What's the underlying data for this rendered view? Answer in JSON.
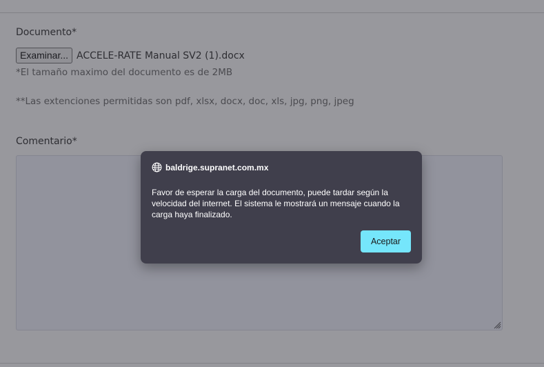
{
  "form": {
    "document_label": "Documento*",
    "browse_button_label": "Examinar...",
    "selected_file_name": "ACCELE-RATE Manual SV2 (1).docx",
    "max_size_note": "*El tamaño maximo del documento es de 2MB",
    "allowed_extensions_note": "**Las extenciones permitidas son pdf, xlsx, docx, doc, xls, jpg, png, jpeg",
    "comment_label": "Comentario*",
    "comment_value": ""
  },
  "dialog": {
    "origin": "baldrige.supranet.com.mx",
    "origin_icon": "globe-icon",
    "message": "Favor de esperar la carga del documento, puede tardar según la velocidad del internet. El sistema le mostrará un mensaje cuando la carga haya finalizado.",
    "accept_label": "Aceptar"
  },
  "colors": {
    "dialog_background": "#403f4c",
    "accept_button": "#75e6fb",
    "overlay": "#282832"
  }
}
